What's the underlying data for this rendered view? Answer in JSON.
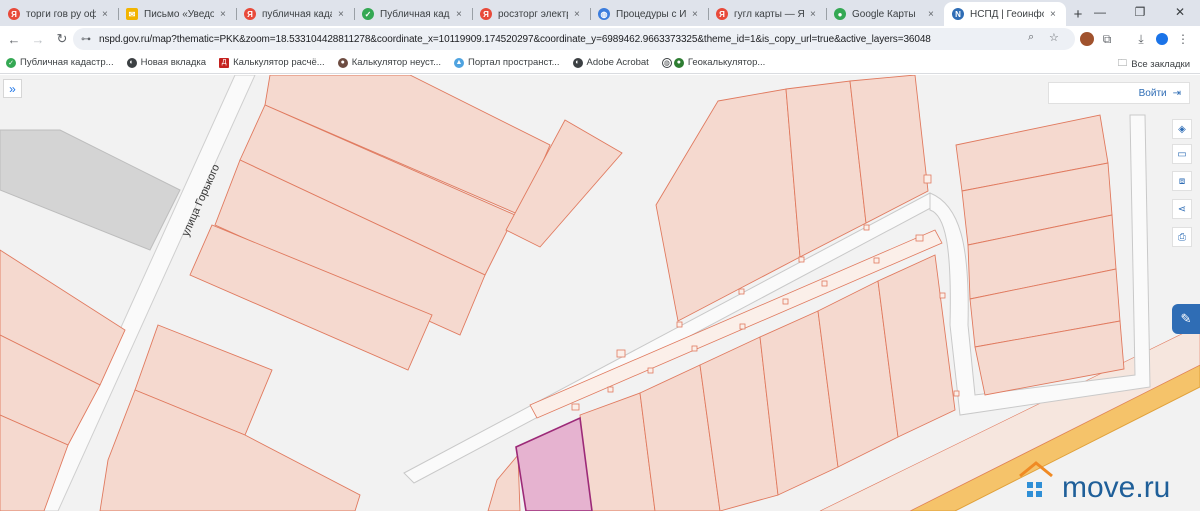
{
  "tabs": [
    {
      "title": "торги гов ру официальн",
      "favicon_color": "#e84a3a",
      "favicon": "search-engine-icon"
    },
    {
      "title": "Письмо «Уведомление",
      "favicon_color": "#f2b400",
      "favicon": "mail-icon"
    },
    {
      "title": "публичная кадастровая",
      "favicon_color": "#e84a3a",
      "favicon": "search-engine-icon"
    },
    {
      "title": "Публичная кадастровая",
      "favicon_color": "#34a853",
      "favicon": "cadastre-icon"
    },
    {
      "title": "росзторг электронны",
      "favicon_color": "#e84a3a",
      "favicon": "search-engine-icon"
    },
    {
      "title": "Процедуры с Имуществом",
      "favicon_color": "#3b7ddd",
      "favicon": "globe-icon"
    },
    {
      "title": "гугл карты — Яндекс",
      "favicon_color": "#e84a3a",
      "favicon": "search-engine-icon"
    },
    {
      "title": "Google Карты",
      "favicon_color": "#34a853",
      "favicon": "map-pin-icon"
    },
    {
      "title": "НСПД | Геоинформационная",
      "favicon_color": "#2f6db5",
      "favicon": "nspd-icon",
      "active": true
    }
  ],
  "browser": {
    "url": "nspd.gov.ru/map?thematic=PKK&zoom=18.533104428811278&coordinate_x=10119909.174520297&coordinate_y=6989462.9663373325&theme_id=1&is_copy_url=true&active_layers=36048",
    "tab_close": "×",
    "new_tab": "+"
  },
  "bookmarks": [
    {
      "label": "Публичная кадастр...",
      "color": "#34a853"
    },
    {
      "label": "Новая вкладка",
      "color": "#3c4043"
    },
    {
      "label": "Калькулятор расчё...",
      "color": "#c5221f"
    },
    {
      "label": "Калькулятор неуст...",
      "color": "#6d4c41"
    },
    {
      "label": "Портал пространст...",
      "color": "#4fa3e0"
    },
    {
      "label": "Adobe Acrobat",
      "color": "#3c4043"
    },
    {
      "label": "Геокалькулятор...",
      "color": "#2e7d32"
    }
  ],
  "all_bookmarks": "Все закладки",
  "map": {
    "street_label": "улица Горького",
    "login_label": "Войти",
    "sidebar_toggle": "»"
  },
  "watermark": {
    "text": "move.ru"
  },
  "colors": {
    "parcel_fill": "#f5d9cf",
    "parcel_stroke": "#e07a5f",
    "selected_fill": "#e6b3d0",
    "selected_stroke": "#9c2a78",
    "highway": "#f5c36a",
    "accent": "#2f6db5"
  }
}
